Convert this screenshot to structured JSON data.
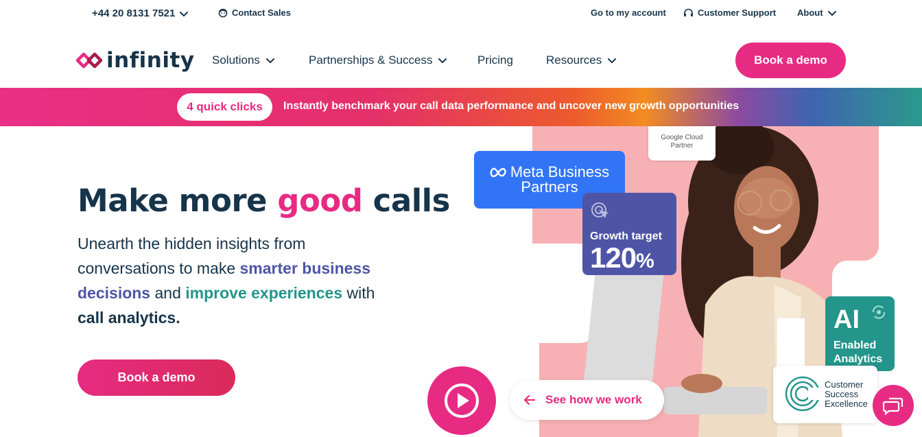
{
  "utility": {
    "phone": "+44 20 8131 7521",
    "contact_sales": "Contact Sales",
    "account": "Go to my account",
    "support": "Customer Support",
    "about": "About"
  },
  "nav": {
    "logo_text": "infinity",
    "solutions": "Solutions",
    "partnerships": "Partnerships & Success",
    "pricing": "Pricing",
    "resources": "Resources",
    "cta": "Book a demo"
  },
  "banner": {
    "pill": "4 quick clicks",
    "text": "Instantly benchmark your call data performance and uncover new growth opportunities"
  },
  "hero": {
    "title_part1": "Make more ",
    "title_highlight": "good",
    "title_part2": " calls",
    "sub_part1": "Unearth the hidden insights from conversations to make ",
    "sub_purple": "smarter business decisions",
    "sub_part2": " and ",
    "sub_teal": "improve experiences",
    "sub_part3": " with ",
    "sub_bold": "call analytics.",
    "cta": "Book a demo"
  },
  "cards": {
    "google_line1": "Google Cloud",
    "google_line2": "Partner",
    "meta_line1": "Meta Business",
    "meta_line2": "Partners",
    "growth_label": "Growth target",
    "growth_value": "120",
    "growth_unit": "%",
    "ai_big": "AI",
    "ai_line1": "Enabled",
    "ai_line2": "Analytics",
    "cse_line1": "Customer",
    "cse_line2": "Success",
    "cse_line3": "Excellence"
  },
  "video": {
    "see_how": "See how we work"
  },
  "colors": {
    "brand_pink": "#e72b82",
    "navy": "#16344a",
    "purple": "#4e55a6",
    "teal": "#23958a",
    "meta_blue": "#3175f6",
    "salmon": "#f7b1b4"
  }
}
